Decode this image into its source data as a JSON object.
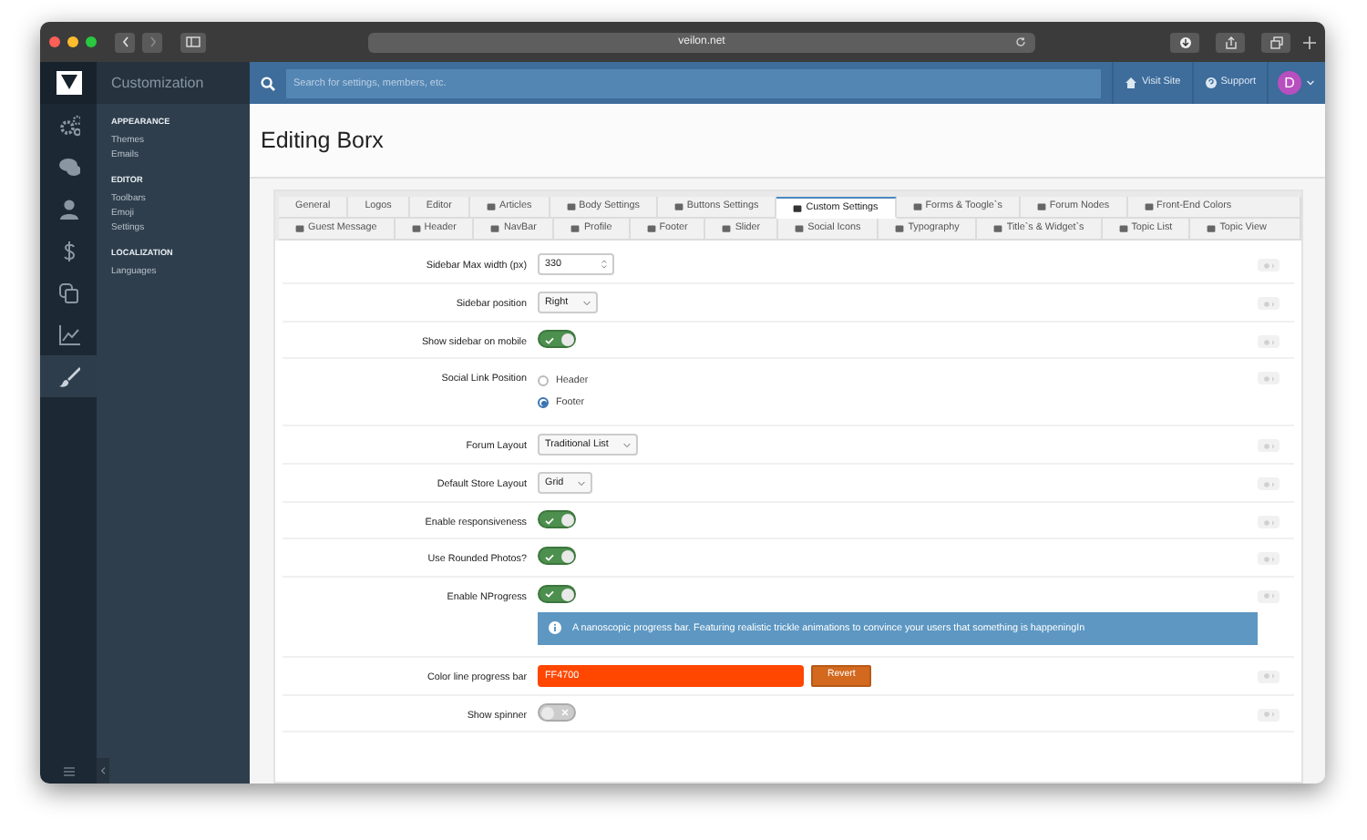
{
  "browser": {
    "url": "veilon.net"
  },
  "rail_items": [
    {
      "selected": false
    },
    {
      "selected": false
    },
    {
      "selected": false
    },
    {
      "selected": false
    },
    {
      "selected": false
    },
    {
      "selected": false
    },
    {
      "selected": true
    }
  ],
  "sidebar": {
    "title": "Customization",
    "groups": [
      {
        "heading": "APPEARANCE",
        "items": [
          "Themes",
          "Emails"
        ]
      },
      {
        "heading": "EDITOR",
        "items": [
          "Toolbars",
          "Emoji",
          "Settings"
        ]
      },
      {
        "heading": "LOCALIZATION",
        "items": [
          "Languages"
        ]
      }
    ]
  },
  "topbar": {
    "search_placeholder": "Search for settings, members, etc.",
    "links": [
      "Visit Site",
      "Support"
    ],
    "avatar": "D"
  },
  "page_title": "Editing Borx",
  "tabs": [
    [
      {
        "label": "General",
        "kind": "plain",
        "selected": false
      },
      {
        "label": "Logos",
        "kind": "plain",
        "selected": false
      },
      {
        "label": "Editor",
        "kind": "plain",
        "selected": false
      },
      {
        "label": "Articles",
        "kind": "icon",
        "selected": false
      },
      {
        "label": "Body Settings",
        "kind": "icon",
        "selected": false
      },
      {
        "label": "Buttons Settings",
        "kind": "icon",
        "selected": false
      },
      {
        "label": "Custom Settings",
        "kind": "icon",
        "selected": true
      },
      {
        "label": "Forms & Toogle`s",
        "kind": "icon",
        "selected": false
      },
      {
        "label": "Forum Nodes",
        "kind": "icon",
        "selected": false
      },
      {
        "label": "Front-End Colors",
        "kind": "icon",
        "selected": false
      }
    ],
    [
      {
        "label": "Guest Message",
        "kind": "icon",
        "selected": false
      },
      {
        "label": "Header",
        "kind": "icon",
        "selected": false
      },
      {
        "label": "NavBar",
        "kind": "icon",
        "selected": false
      },
      {
        "label": "Profile",
        "kind": "icon",
        "selected": false
      },
      {
        "label": "Footer",
        "kind": "icon",
        "selected": false
      },
      {
        "label": "Slider",
        "kind": "icon",
        "selected": false
      },
      {
        "label": "Social Icons",
        "kind": "icon",
        "selected": false
      },
      {
        "label": "Typography",
        "kind": "icon",
        "selected": false
      },
      {
        "label": "Title`s & Widget`s",
        "kind": "icon",
        "selected": false
      },
      {
        "label": "Topic List",
        "kind": "icon",
        "selected": false
      },
      {
        "label": "Topic View",
        "kind": "icon",
        "selected": false
      }
    ]
  ],
  "settings": [
    {
      "label": "Sidebar Max width (px)",
      "kind": "number",
      "value": "330"
    },
    {
      "label": "Sidebar position",
      "kind": "select",
      "value": "Right"
    },
    {
      "label": "Show sidebar on mobile",
      "kind": "toggle",
      "on": true
    },
    {
      "label": "Social Link Position",
      "kind": "radio",
      "options": [
        {
          "label": "Header",
          "selected": false
        },
        {
          "label": "Footer",
          "selected": true
        }
      ]
    },
    {
      "label": "Forum Layout",
      "kind": "select",
      "value": "Traditional List"
    },
    {
      "label": "Default Store Layout",
      "kind": "select",
      "value": "Grid"
    },
    {
      "label": "Enable responsiveness",
      "kind": "toggle",
      "on": true
    },
    {
      "label": "Use Rounded Photos?",
      "kind": "toggle",
      "on": true
    },
    {
      "label": "Enable NProgress",
      "kind": "toggle",
      "on": true,
      "info": "A nanoscopic progress bar. Featuring realistic trickle animations to convince your users that something is happeningIn"
    },
    {
      "label": "Color line progress bar",
      "kind": "color",
      "value": "FF4700",
      "color": "#ff4700",
      "button": "Revert"
    },
    {
      "label": "Show spinner",
      "kind": "toggle",
      "on": false
    }
  ]
}
